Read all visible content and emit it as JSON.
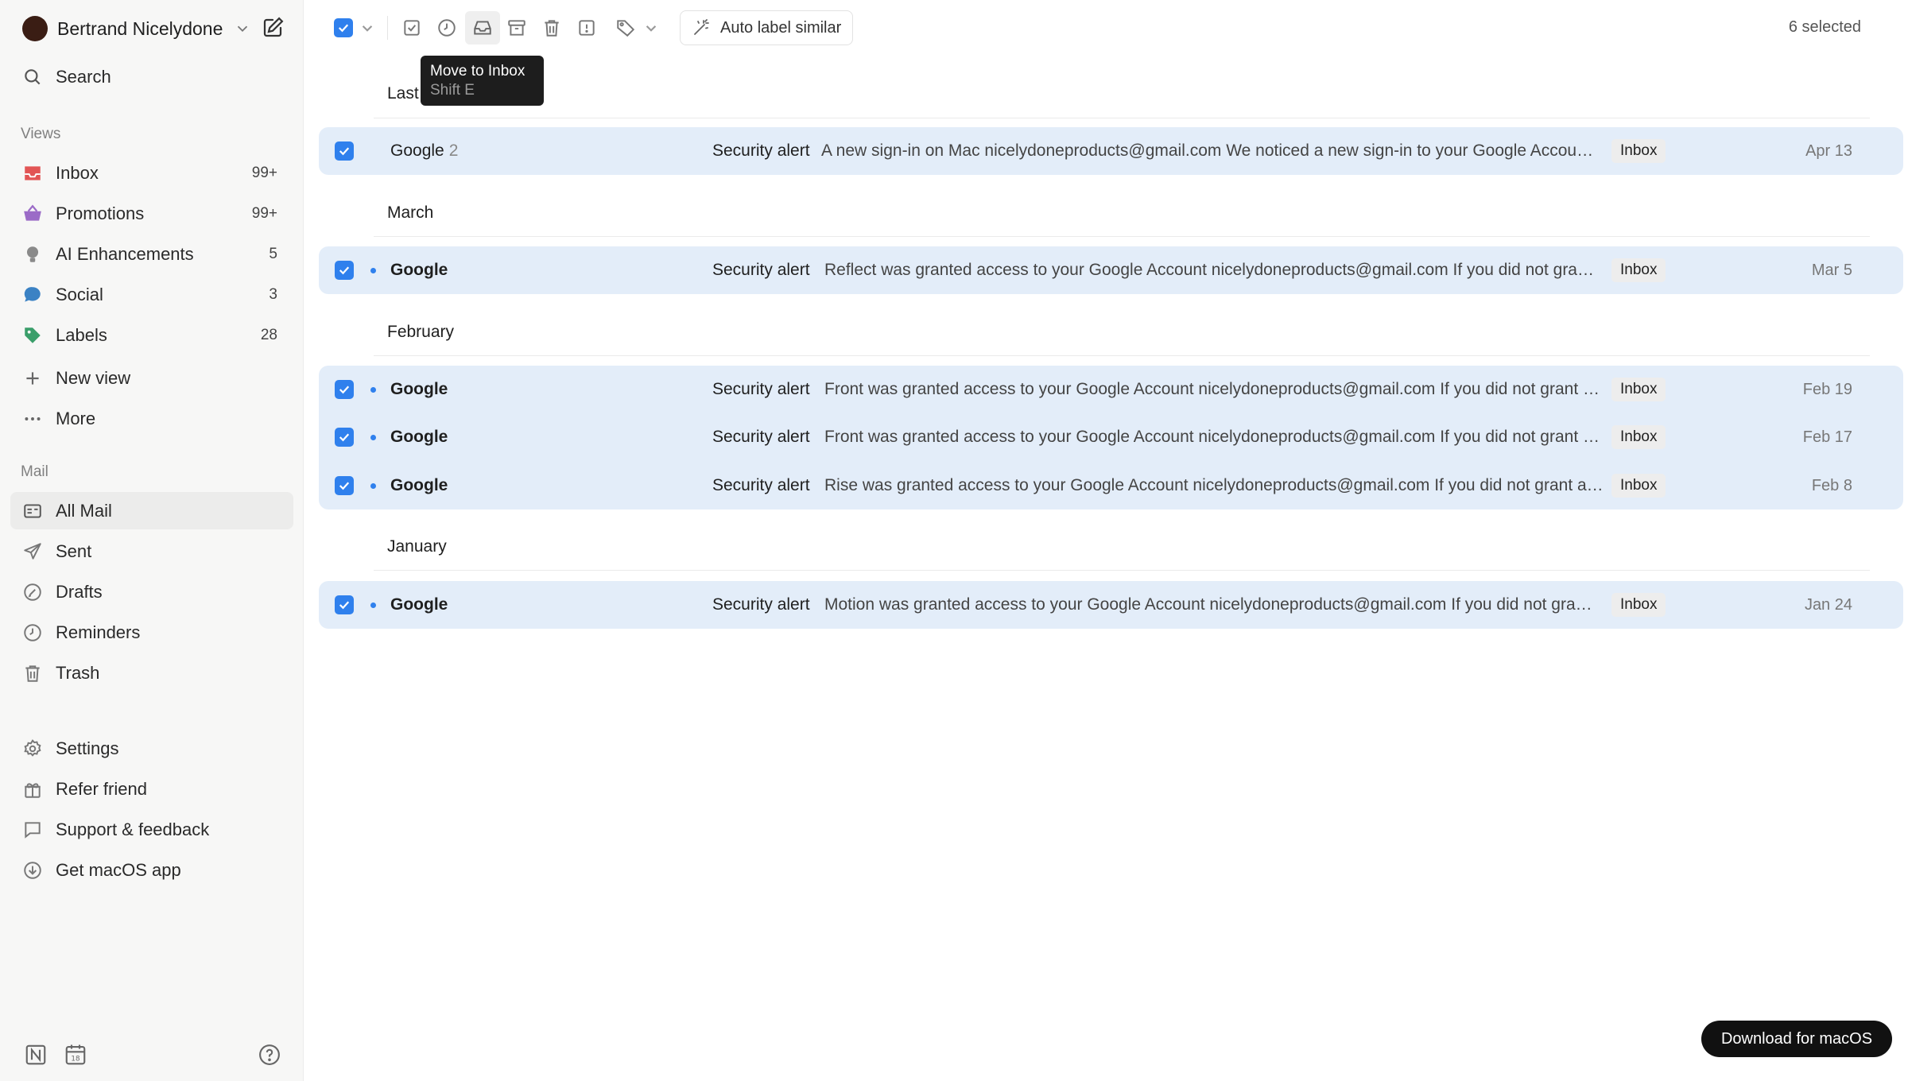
{
  "account": {
    "name": "Bertrand Nicelydone"
  },
  "search": {
    "label": "Search"
  },
  "sidebar": {
    "views_title": "Views",
    "views": [
      {
        "label": "Inbox",
        "count": "99+",
        "icon": "inbox-icon",
        "color": "#e25555"
      },
      {
        "label": "Promotions",
        "count": "99+",
        "icon": "basket-icon",
        "color": "#9b6bc7"
      },
      {
        "label": "AI Enhancements",
        "count": "5",
        "icon": "bulb-icon",
        "color": "#8a8a8a"
      },
      {
        "label": "Social",
        "count": "3",
        "icon": "chat-bubble-icon",
        "color": "#3b82c4"
      },
      {
        "label": "Labels",
        "count": "28",
        "icon": "tag-icon",
        "color": "#3a9e6a"
      }
    ],
    "new_view": "New view",
    "more": "More",
    "mail_title": "Mail",
    "mail": [
      {
        "label": "All Mail",
        "icon": "all-mail-icon",
        "active": true
      },
      {
        "label": "Sent",
        "icon": "send-icon"
      },
      {
        "label": "Drafts",
        "icon": "draft-icon"
      },
      {
        "label": "Reminders",
        "icon": "clock-icon"
      },
      {
        "label": "Trash",
        "icon": "trash-icon"
      }
    ],
    "footer": [
      {
        "label": "Settings",
        "icon": "gear-icon"
      },
      {
        "label": "Refer friend",
        "icon": "gift-icon"
      },
      {
        "label": "Support & feedback",
        "icon": "message-icon"
      },
      {
        "label": "Get macOS app",
        "icon": "download-icon"
      }
    ]
  },
  "toolbar": {
    "auto_label": "Auto label similar",
    "selected_count": "6 selected",
    "tooltip_title": "Move to Inbox",
    "tooltip_shortcut": "Shift E"
  },
  "groups": [
    {
      "title": "Last",
      "emails": [
        {
          "sender": "Google",
          "thread_count": "2",
          "unread": false,
          "subject": "Security alert",
          "snippet": "A new sign-in on Mac nicelydoneproducts@gmail.com We noticed a new sign-in to your Google Account on a Mac device.",
          "tag": "Inbox",
          "date": "Apr 13"
        }
      ]
    },
    {
      "title": "March",
      "emails": [
        {
          "sender": "Google",
          "unread": true,
          "subject": "Security alert",
          "snippet": "Reflect was granted access to your Google Account nicelydoneproducts@gmail.com If you did not grant access, you should check this activity.",
          "tag": "Inbox",
          "date": "Mar 5"
        }
      ]
    },
    {
      "title": "February",
      "emails": [
        {
          "sender": "Google",
          "unread": true,
          "subject": "Security alert",
          "snippet": "Front was granted access to your Google Account nicelydoneproducts@gmail.com If you did not grant access, you should check this activity.",
          "tag": "Inbox",
          "date": "Feb 19"
        },
        {
          "sender": "Google",
          "unread": true,
          "subject": "Security alert",
          "snippet": "Front was granted access to your Google Account nicelydoneproducts@gmail.com If you did not grant access, you should check this activity.",
          "tag": "Inbox",
          "date": "Feb 17"
        },
        {
          "sender": "Google",
          "unread": true,
          "subject": "Security alert",
          "snippet": "Rise was granted access to your Google Account nicelydoneproducts@gmail.com If you did not grant access, you should check this activity.",
          "tag": "Inbox",
          "date": "Feb 8"
        }
      ]
    },
    {
      "title": "January",
      "emails": [
        {
          "sender": "Google",
          "unread": true,
          "subject": "Security alert",
          "snippet": "Motion was granted access to your Google Account nicelydoneproducts@gmail.com If you did not grant access, you should check this activity.",
          "tag": "Inbox",
          "date": "Jan 24"
        }
      ]
    }
  ],
  "download_button": "Download for macOS"
}
